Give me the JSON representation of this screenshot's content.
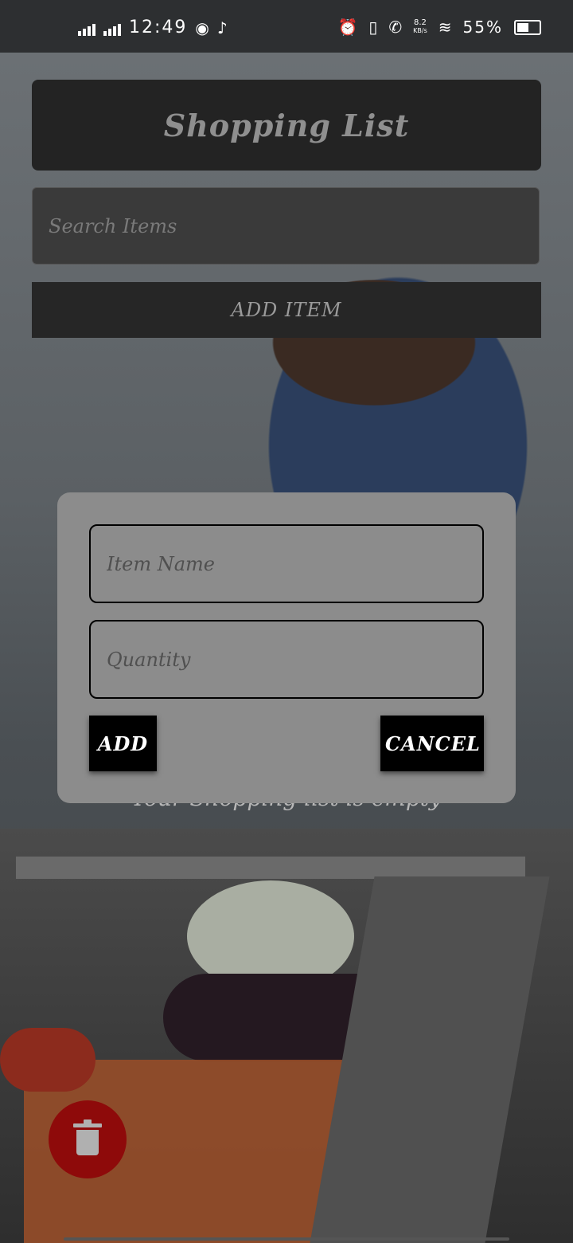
{
  "status_bar": {
    "time": "12:49",
    "speed_value": "8.2",
    "speed_unit": "KB/s",
    "battery": "55%",
    "battery_level": 0.55
  },
  "header": {
    "title": "Shopping List"
  },
  "search": {
    "placeholder": "Search Items"
  },
  "toolbar": {
    "add_item_label": "ADD ITEM"
  },
  "list": {
    "empty_message": "Your Shopping list is empty"
  },
  "dialog": {
    "item_name_placeholder": "Item Name",
    "quantity_placeholder": "Quantity",
    "add_label": "ADD",
    "cancel_label": "CANCEL"
  },
  "fab": {
    "icon": "trash-icon",
    "color": "#8e0a0a"
  }
}
